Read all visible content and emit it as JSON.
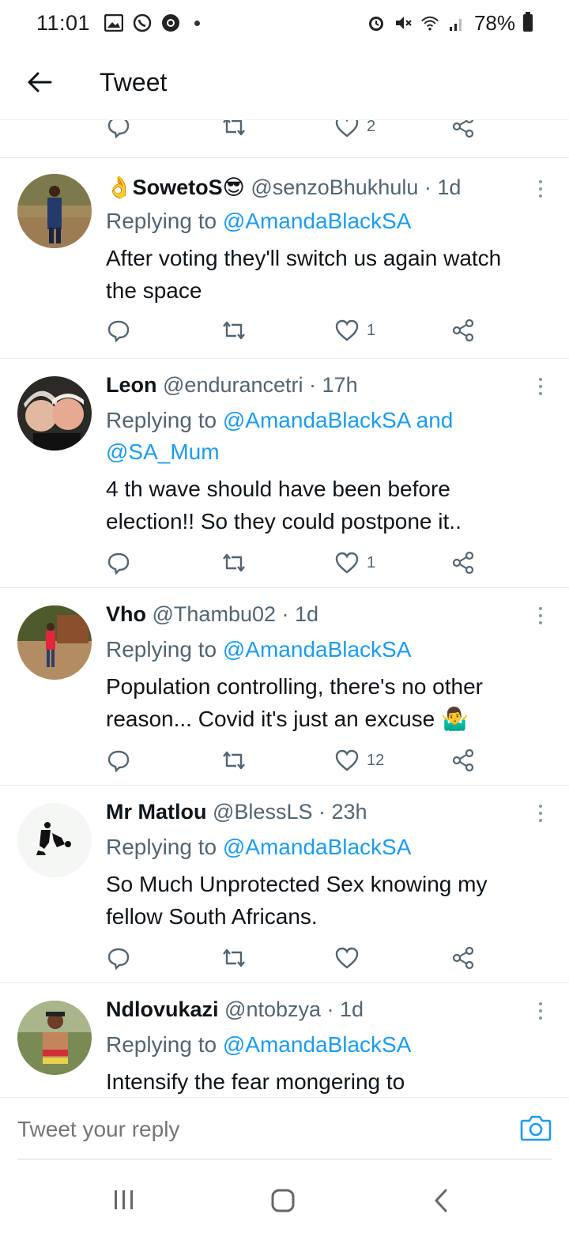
{
  "status_bar": {
    "time": "11:01",
    "battery": "78%",
    "icons_left": [
      "gallery-icon",
      "whatsapp-icon",
      "chrome-icon"
    ],
    "icons_right": [
      "alarm-icon",
      "mute-icon",
      "wifi-icon",
      "signal-icon",
      "battery-icon"
    ]
  },
  "header": {
    "title": "Tweet"
  },
  "top_actions": {
    "like_count": "2"
  },
  "tweets": [
    {
      "name": "SowetoS😎",
      "prefix_emoji": "👌",
      "handle": "@senzoBhukhulu",
      "time": "· 1d",
      "reply_prefix": "Replying to",
      "reply_to": "@AmandaBlackSA",
      "reply_to_2": "",
      "text_line1": "After voting they'll switch us again watch",
      "text_line2": "the space",
      "like_count": "1"
    },
    {
      "name": "Leon",
      "handle": "@endurancetri",
      "time": "· 17h",
      "reply_prefix": "Replying to",
      "reply_to": "@AmandaBlackSA and",
      "reply_to_2": "@SA_Mum",
      "text_line1": "4 th wave should have been before",
      "text_line2": "election!! So they could postpone it..",
      "like_count": "1"
    },
    {
      "name": "Vho",
      "handle": "@Thambu02",
      "time": "· 1d",
      "reply_prefix": "Replying to",
      "reply_to": "@AmandaBlackSA",
      "text_line1": "Population controlling, there's no other",
      "text_line2": "reason... Covid it's just an excuse 🤷‍♂️",
      "like_count": "12"
    },
    {
      "name": "Mr Matlou",
      "handle": "@BlessLS",
      "time": "· 23h",
      "reply_prefix": "Replying to",
      "reply_to": "@AmandaBlackSA",
      "text_line1": "So Much Unprotected Sex knowing my",
      "text_line2": "fellow South Africans.",
      "like_count": ""
    },
    {
      "name": "Ndlovukazi",
      "handle": "@ntobzya",
      "time": "· 1d",
      "reply_prefix": "Replying to",
      "reply_to": "@AmandaBlackSA",
      "text_line1": "Intensify the fear mongering to"
    }
  ],
  "reply_bar": {
    "placeholder": "Tweet your reply"
  },
  "colors": {
    "accent": "#1d9bf0",
    "secondary_text": "#536471",
    "primary_text": "#0f1419",
    "divider": "#e6ecf0"
  }
}
